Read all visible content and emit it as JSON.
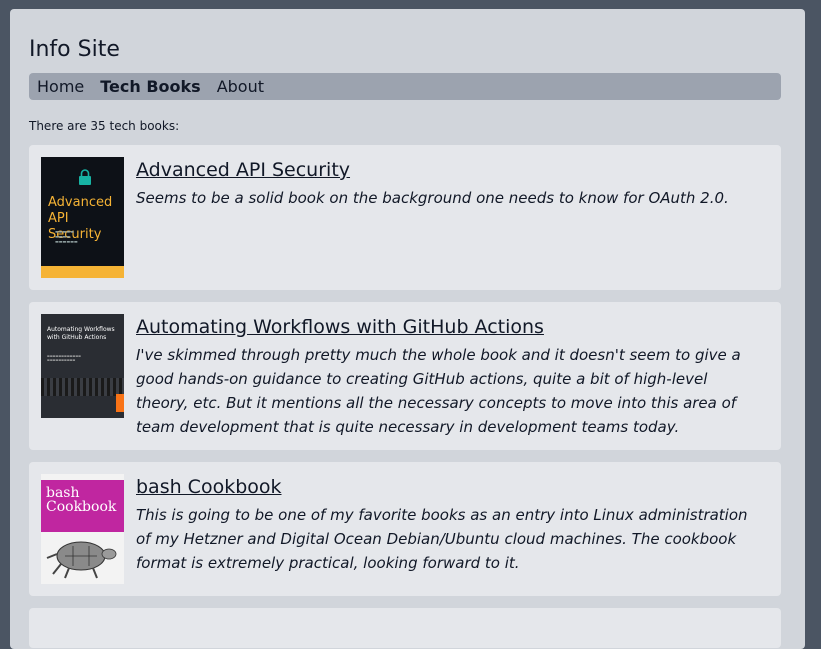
{
  "site": {
    "title": "Info Site"
  },
  "nav": {
    "items": [
      "Home",
      "Tech Books",
      "About"
    ],
    "active": "Tech Books"
  },
  "count_text": "There are 35 tech books:",
  "books": [
    {
      "title": "Advanced API Security",
      "description": "Seems to be a solid book on the background one needs to know for OAuth 2.0.",
      "cover": {
        "heading": "Advanced API Security",
        "colors": {
          "bg": "#0d1117",
          "accent": "#f5b335"
        }
      }
    },
    {
      "title": "Automating Workflows with GitHub Actions",
      "description": "I've skimmed through pretty much the whole book and it doesn't seem to give a good hands-on guidance to creating GitHub actions, quite a bit of high-level theory, etc. But it mentions all the necessary concepts to move into this area of team development that is quite necessary in development teams today.",
      "cover": {
        "heading": "Automating Workflows with GitHub Actions",
        "colors": {
          "bg": "#2a2d33",
          "accent": "#f97316"
        }
      }
    },
    {
      "title": "bash Cookbook",
      "description": "This is going to be one of my favorite books as an entry into Linux administration of my Hetzner and Digital Ocean Debian/Ubuntu cloud machines. The cookbook format is extremely practical, looking forward to it.",
      "cover": {
        "heading": "bash Cookbook",
        "colors": {
          "bg": "#f3f3f3",
          "accent": "#c026a0"
        }
      }
    }
  ],
  "colors": {
    "page_bg": "#d1d5db",
    "outer_bg": "#4b5563",
    "nav_bg": "#9ca3af",
    "card_bg": "#e5e7eb"
  }
}
